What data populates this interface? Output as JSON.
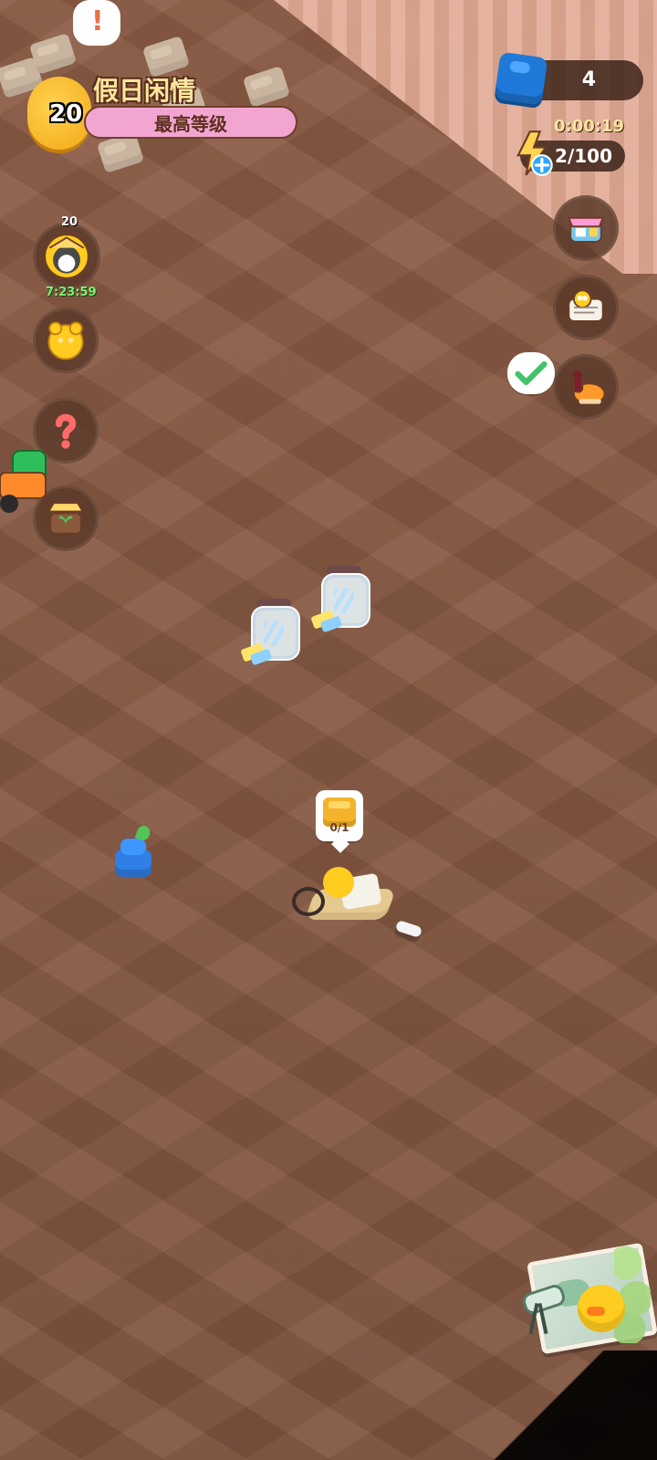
{
  "header": {
    "level": "20",
    "title": "假日闲情",
    "level_label": "最高等级"
  },
  "resources": {
    "gems": "4",
    "energy_timer": "0:00:19",
    "energy": "2/100"
  },
  "left_buttons": {
    "profile_badge_level": "20",
    "profile_timer": "7:23:59"
  },
  "board": {
    "crate_count": "0/1"
  },
  "icons": [
    "warning-pin-icon",
    "gem-icon",
    "energy-bolt-icon",
    "shop-icon",
    "newspaper-icon",
    "food-icon",
    "check-icon",
    "avatar-icon",
    "bear-icon",
    "help-icon",
    "garden-icon",
    "map-icon"
  ],
  "colors": {
    "board": "#8c5c45",
    "gem": "#1f79d8",
    "energy": "#ffd24f",
    "accent_pink": "#f3a5d2",
    "timer_green": "#7df071"
  }
}
